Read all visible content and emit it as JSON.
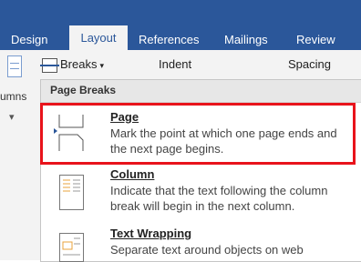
{
  "tabs": [
    {
      "label": "Design",
      "active": false
    },
    {
      "label": "Layout",
      "active": true
    },
    {
      "label": "References",
      "active": false
    },
    {
      "label": "Mailings",
      "active": false
    },
    {
      "label": "Review",
      "active": false
    }
  ],
  "ribbon": {
    "breaks_label": "Breaks",
    "indent_label": "Indent",
    "spacing_label": "Spacing",
    "columns_partial": "umns"
  },
  "menu": {
    "header": "Page Breaks",
    "items": [
      {
        "title": "Page",
        "desc": "Mark the point at which one page ends and the next page begins.",
        "icon": "page-break-icon"
      },
      {
        "title": "Column",
        "desc": "Indicate that the text following the column break will begin in the next column.",
        "icon": "column-break-icon"
      },
      {
        "title": "Text Wrapping",
        "desc": "Separate text around objects on web",
        "icon": "text-wrapping-icon"
      }
    ]
  },
  "colors": {
    "ribbon": "#2b579a",
    "highlight": "#e8131b",
    "accent": "#2b579a"
  }
}
